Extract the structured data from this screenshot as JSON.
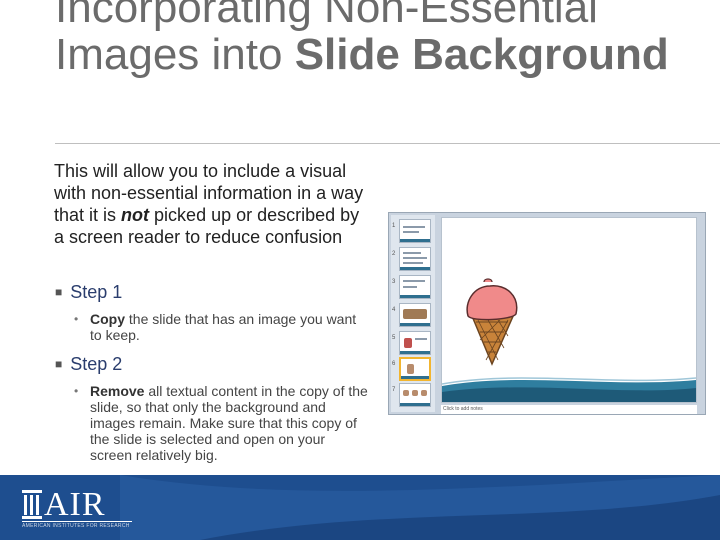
{
  "slide": {
    "title_regular": "Incorporating Non-Essential Images into",
    "title_bold": "Slide Background",
    "intro_before": "This will allow you to include a visual with non-essential information in a way that it is",
    "intro_emphasis": "not",
    "intro_after": "picked up or described by a screen reader to reduce confusion",
    "steps": [
      {
        "label": "Step 1",
        "bullet_bold": "Copy",
        "bullet_text": "the slide that has an image you want to keep."
      },
      {
        "label": "Step 2",
        "bullet_bold": "Remove",
        "bullet_text": "all textual content in the copy of the slide, so that only the background and images remain. Make sure that this copy of the slide is selected and open on your screen relatively big."
      }
    ]
  },
  "screenshot": {
    "notes_placeholder": "Click to add notes",
    "thumb_numbers": [
      "1",
      "2",
      "3",
      "4",
      "5",
      "6",
      "7"
    ]
  },
  "footer": {
    "logo_text": "AIR",
    "logo_subtext": "AMERICAN INSTITUTES FOR RESEARCH"
  },
  "colors": {
    "footer_blue": "#1e4e8f",
    "step_label": "#2a3d6d",
    "selected_thumb": "#f2b530"
  }
}
